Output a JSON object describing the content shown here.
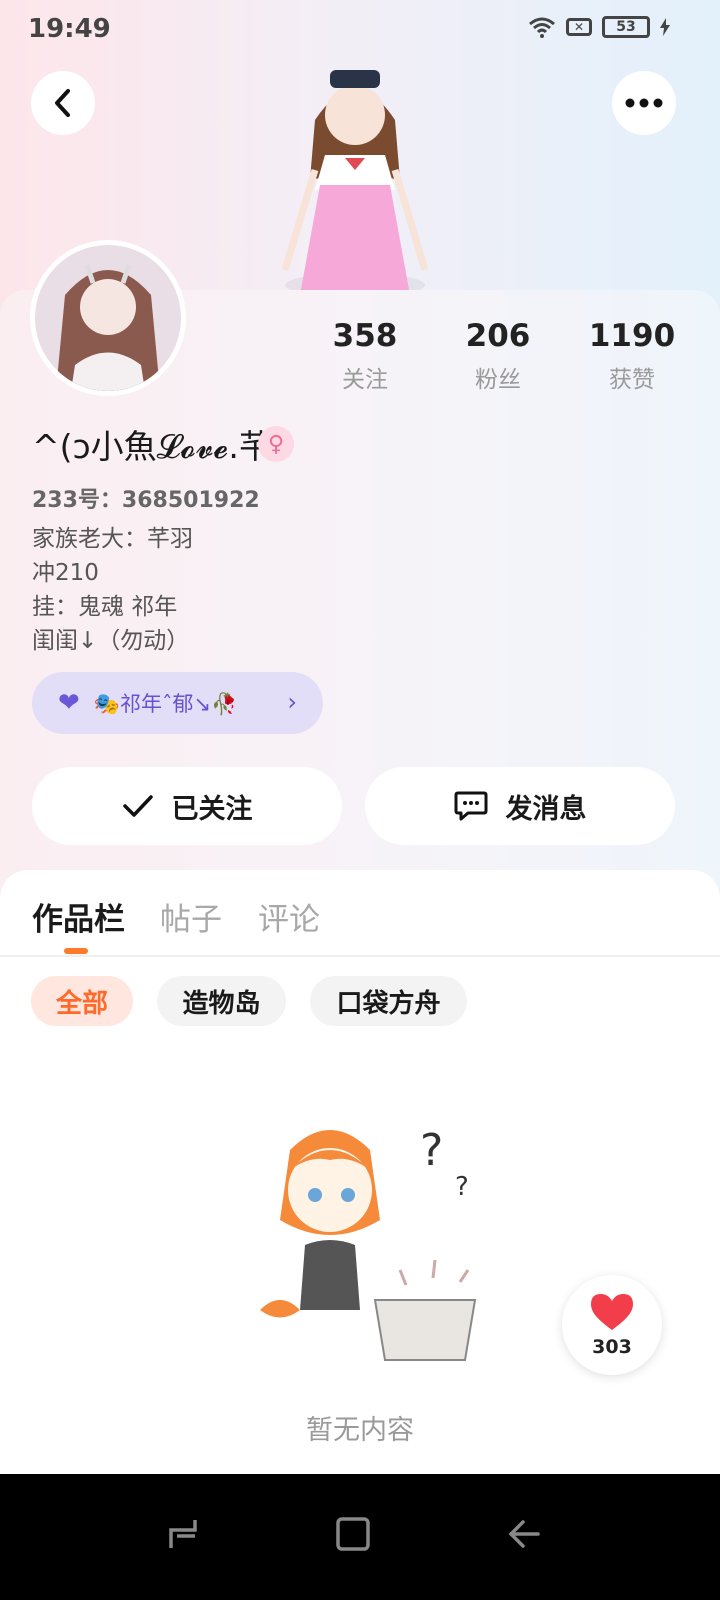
{
  "status_bar": {
    "time": "19:49",
    "battery": "53",
    "icons": [
      "wifi-icon",
      "signal-off-icon",
      "battery-icon",
      "charging-icon"
    ]
  },
  "header": {
    "back_icon": "chevron-left-icon",
    "more_icon": "more-dots-icon"
  },
  "profile": {
    "stats": [
      {
        "value": "358",
        "label": "关注"
      },
      {
        "value": "206",
        "label": "粉丝"
      },
      {
        "value": "1190",
        "label": "获赞"
      }
    ],
    "nickname": "^(ↄ小魚𝓛𝓸𝓿𝓮.芊",
    "gender_icon": "female-icon",
    "uid": "233号：368501922",
    "bio_lines": [
      "家族老大：芊羽",
      "冲210",
      "挂：鬼魂 祁年",
      "闺闺↓（勿动）"
    ],
    "family_chip": "🎭祁年ˆ郁↘🥀"
  },
  "actions": {
    "follow_label": "已关注",
    "message_label": "发消息"
  },
  "tabs": [
    {
      "label": "作品栏",
      "active": true
    },
    {
      "label": "帖子",
      "active": false
    },
    {
      "label": "评论",
      "active": false
    }
  ],
  "filters": [
    {
      "label": "全部",
      "active": true
    },
    {
      "label": "造物岛",
      "active": false
    },
    {
      "label": "口袋方舟",
      "active": false
    }
  ],
  "empty_text": "暂无内容",
  "like_fab": {
    "count": "303"
  },
  "colors": {
    "accent": "#ff7a2a",
    "family_chip_bg": "#e3def7",
    "family_chip_text": "#6653cf"
  }
}
